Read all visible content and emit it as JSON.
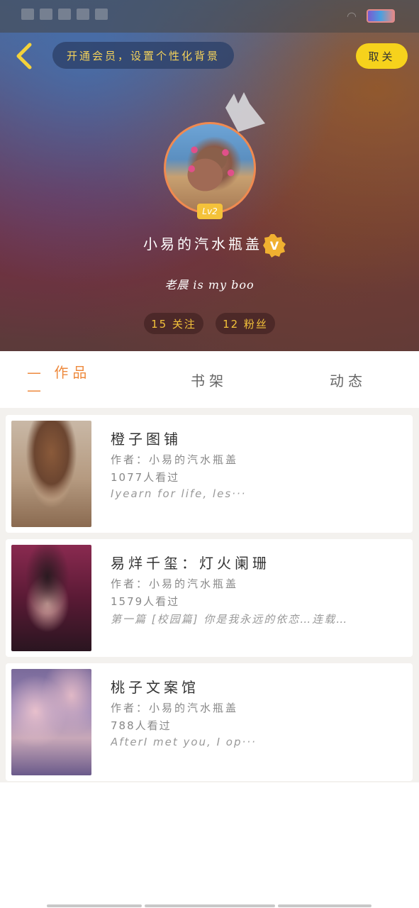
{
  "header": {
    "vip_banner": "开通会员，设置个性化背景",
    "cancel_label": "取关",
    "level": "Lv2",
    "nickname": "小易的汽水瓶盖",
    "signature": "老晨 is my boo",
    "following": "15 关注",
    "followers": "12 粉丝"
  },
  "tabs": [
    {
      "label": "— 作品 —",
      "active": true
    },
    {
      "label": "书架",
      "active": false
    },
    {
      "label": "动态",
      "active": false
    }
  ],
  "works": [
    {
      "title": "橙子图铺",
      "author": "作者：小易的汽水瓶盖",
      "views": "1077人看过",
      "desc": "Iyearn for life, les···"
    },
    {
      "title": "易烊千玺：灯火阑珊",
      "author": "作者：小易的汽水瓶盖",
      "views": "1579人看过",
      "desc": "第一篇 [校园篇] 你是我永远的依恋…连载…"
    },
    {
      "title": "桃子文案馆",
      "author": "作者：小易的汽水瓶盖",
      "views": "788人看过",
      "desc": "AfterI met you, I op···"
    }
  ],
  "colors": {
    "accent": "#ee8a3e",
    "cancel_bg": "#f6d21c",
    "stat_text": "#f4c23a",
    "vip_text": "#f4d25a"
  },
  "icons": [
    "back-arrow-icon",
    "crown-icon",
    "verified-icon",
    "wifi-icon",
    "battery-icon"
  ]
}
